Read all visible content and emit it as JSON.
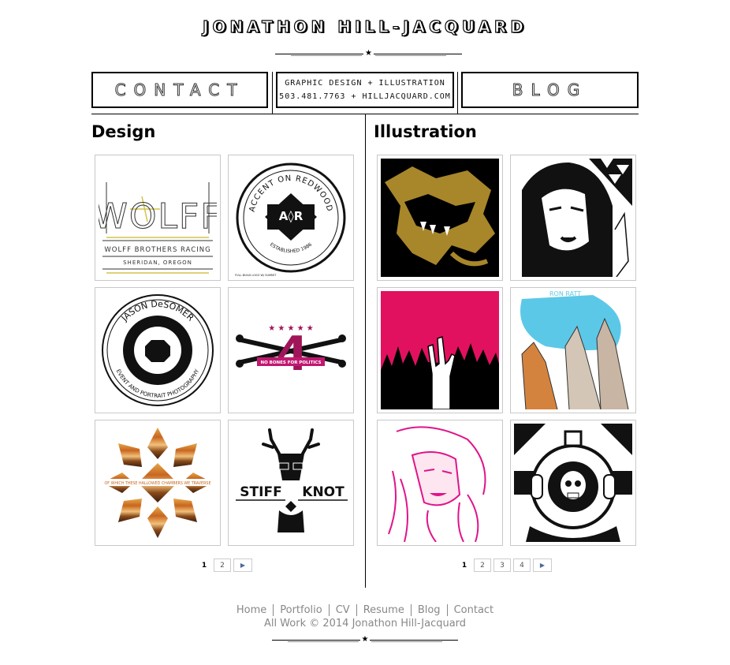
{
  "header": {
    "site_title": "JONATHON HILL-JACQUARD"
  },
  "nav": {
    "contact_label": "CONTACT",
    "tagline": "GRAPHIC DESIGN + ILLUSTRATION",
    "contact_info": "503.481.7763  +  HILLJACQUARD.COM",
    "blog_label": "BLOG"
  },
  "design": {
    "title": "Design",
    "items": [
      {
        "icon": "wolff-brothers-racing-logo",
        "text1": "WOLFF",
        "text2": "WOLFF BROTHERS RACING",
        "text3": "SHERIDAN, OREGON"
      },
      {
        "icon": "accent-on-redwood-logo",
        "text1": "ACCENT ON REDWOOD",
        "text2": "ESTABLISHED 1986",
        "text3": "FULL BUILD LOGO W/ SUMMIT"
      },
      {
        "icon": "jason-desomer-photography-logo",
        "text1": "JASON DeSOMER",
        "text2": "EVENT AND PORTRAIT PHOTOGRAPHY"
      },
      {
        "icon": "4-no-bones-logo",
        "text1": "4",
        "text2": "NO BONES   FOR POLITICS"
      },
      {
        "icon": "snowflake-emblem-logo",
        "text1": "OF WHICH THESE HALLOWED CHAMBERS WE TRAVERSE"
      },
      {
        "icon": "stiff-knot-deer-logo",
        "text1": "STIFF",
        "text2": "KNOT"
      }
    ],
    "pagination": {
      "current": "1",
      "pages": [
        "2"
      ],
      "next": "▶"
    }
  },
  "illustration": {
    "title": "Illustration",
    "items": [
      {
        "icon": "gold-wolf-illustration"
      },
      {
        "icon": "hooded-woman-illustration"
      },
      {
        "icon": "rock-hand-crowd-illustration"
      },
      {
        "icon": "howling-wolves-illustration",
        "text1": "RON RATT"
      },
      {
        "icon": "pink-woman-illustration"
      },
      {
        "icon": "diver-helmet-skull-illustration"
      }
    ],
    "pagination": {
      "current": "1",
      "pages": [
        "2",
        "3",
        "4"
      ],
      "next": "▶"
    }
  },
  "footer": {
    "links": [
      "Home",
      "Portfolio",
      "CV",
      "Resume",
      "Blog",
      "Contact"
    ],
    "copyright": "All Work © 2014 Jonathon Hill-Jacquard"
  },
  "colors": {
    "accent_pink": "#e0105f",
    "gold": "#b8962e",
    "sky_blue": "#5cc8e8"
  }
}
